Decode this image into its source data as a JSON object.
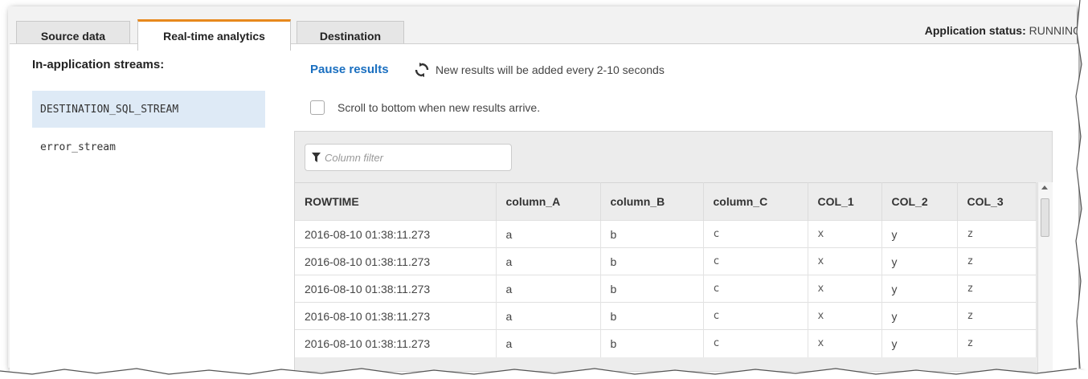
{
  "tabs": [
    {
      "label": "Source data",
      "active": false
    },
    {
      "label": "Real-time analytics",
      "active": true
    },
    {
      "label": "Destination",
      "active": false
    }
  ],
  "app_status": {
    "label": "Application status:",
    "value": "RUNNING"
  },
  "streams": {
    "title": "In-application streams:",
    "items": [
      {
        "label": "DESTINATION_SQL_STREAM",
        "selected": true
      },
      {
        "label": "error_stream",
        "selected": false
      }
    ]
  },
  "controls": {
    "pause_label": "Pause results",
    "refresh_icon": "refresh-icon",
    "refresh_note": "New results will be added every 2-10 seconds",
    "scroll_checkbox_label": "Scroll to bottom when new results arrive.",
    "scroll_checked": false
  },
  "filter": {
    "placeholder": "Column filter",
    "icon": "filter-icon"
  },
  "table": {
    "columns": [
      "ROWTIME",
      "column_A",
      "column_B",
      "column_C",
      "COL_1",
      "COL_2",
      "COL_3"
    ],
    "rows": [
      [
        "2016-08-10 01:38:11.273",
        "a",
        "b",
        "c",
        "x",
        "y",
        "z"
      ],
      [
        "2016-08-10 01:38:11.273",
        "a",
        "b",
        "c",
        "x",
        "y",
        "z"
      ],
      [
        "2016-08-10 01:38:11.273",
        "a",
        "b",
        "c",
        "x",
        "y",
        "z"
      ],
      [
        "2016-08-10 01:38:11.273",
        "a",
        "b",
        "c",
        "x",
        "y",
        "z"
      ],
      [
        "2016-08-10 01:38:11.273",
        "a",
        "b",
        "c",
        "x",
        "y",
        "z"
      ]
    ]
  },
  "colors": {
    "accent_tab": "#e7891d",
    "link": "#1a6fc0",
    "selected_bg": "#deeaf6"
  }
}
